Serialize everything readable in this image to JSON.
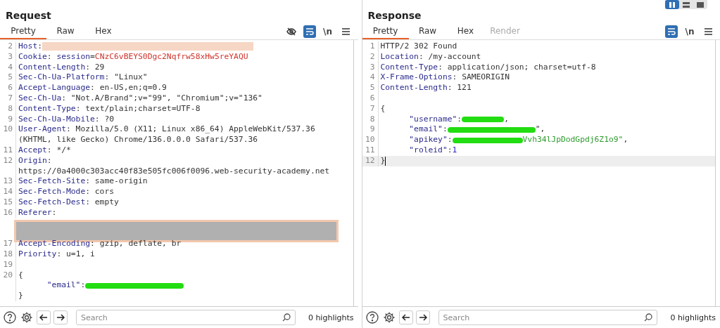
{
  "layout_buttons": [
    {
      "selected": true
    },
    {
      "selected": false
    },
    {
      "selected": false
    }
  ],
  "panels": [
    {
      "title": "Request",
      "tabs": [
        {
          "label": "Pretty",
          "selected": true,
          "disabled": false
        },
        {
          "label": "Raw",
          "selected": false,
          "disabled": false
        },
        {
          "label": "Hex",
          "selected": false,
          "disabled": false
        }
      ],
      "tools": [
        {
          "kind": "hide"
        },
        {
          "kind": "wrap",
          "on": true
        },
        {
          "kind": "newline",
          "text": "\\n"
        },
        {
          "kind": "menu"
        }
      ],
      "lines": [
        {
          "num": "2",
          "segments": [
            {
              "kind": "key",
              "text": "Host"
            },
            {
              "kind": "plain",
              "text": ":"
            },
            {
              "kind": "strike"
            }
          ]
        },
        {
          "num": "3",
          "segments": [
            {
              "kind": "key",
              "text": "Cookie"
            },
            {
              "kind": "plain",
              "text": ": "
            },
            {
              "kind": "param",
              "text": "session"
            },
            {
              "kind": "plain",
              "text": "="
            },
            {
              "kind": "red",
              "text": "CNzC6vBEYS0Dgc2Nqfrw58xHw5reYAQU"
            }
          ]
        },
        {
          "num": "4",
          "segments": [
            {
              "kind": "key",
              "text": "Content-Length"
            },
            {
              "kind": "plain",
              "text": ": 29"
            }
          ]
        },
        {
          "num": "5",
          "segments": [
            {
              "kind": "key",
              "text": "Sec-Ch-Ua-Platform"
            },
            {
              "kind": "plain",
              "text": ": \"Linux\""
            }
          ]
        },
        {
          "num": "6",
          "segments": [
            {
              "kind": "key",
              "text": "Accept-Language"
            },
            {
              "kind": "plain",
              "text": ": en-US,en;q=0.9"
            }
          ]
        },
        {
          "num": "7",
          "segments": [
            {
              "kind": "key",
              "text": "Sec-Ch-Ua"
            },
            {
              "kind": "plain",
              "text": ": \"Not.A/Brand\";v=\"99\", \"Chromium\";v=\"136\""
            }
          ]
        },
        {
          "num": "8",
          "segments": [
            {
              "kind": "key",
              "text": "Content-Type"
            },
            {
              "kind": "plain",
              "text": ": text/plain;charset=UTF-8"
            }
          ]
        },
        {
          "num": "9",
          "segments": [
            {
              "kind": "key",
              "text": "Sec-Ch-Ua-Mobile"
            },
            {
              "kind": "plain",
              "text": ": ?0"
            }
          ]
        },
        {
          "num": "10",
          "segments": [
            {
              "kind": "key",
              "text": "User-Agent"
            },
            {
              "kind": "plain",
              "text": ": Mozilla/5.0 (X11; Linux x86_64) AppleWebKit/537.36"
            }
          ]
        },
        {
          "segments": [
            {
              "kind": "plain",
              "text": "(KHTML, like Gecko) Chrome/136.0.0.0 Safari/537.36"
            }
          ]
        },
        {
          "num": "11",
          "segments": [
            {
              "kind": "key",
              "text": "Accept"
            },
            {
              "kind": "plain",
              "text": ": */*"
            }
          ]
        },
        {
          "num": "12",
          "segments": [
            {
              "kind": "key",
              "text": "Origin"
            },
            {
              "kind": "plain",
              "text": ":"
            }
          ]
        },
        {
          "segments": [
            {
              "kind": "plain",
              "text": "https://0a4000c303acc40f83e505fc006f0096.web-security-academy.net"
            }
          ]
        },
        {
          "num": "13",
          "segments": [
            {
              "kind": "key",
              "text": "Sec-Fetch-Site"
            },
            {
              "kind": "plain",
              "text": ": same-origin"
            }
          ]
        },
        {
          "num": "14",
          "segments": [
            {
              "kind": "key",
              "text": "Sec-Fetch-Mode"
            },
            {
              "kind": "plain",
              "text": ": cors"
            }
          ]
        },
        {
          "num": "15",
          "segments": [
            {
              "kind": "key",
              "text": "Sec-Fetch-Dest"
            },
            {
              "kind": "plain",
              "text": ": empty"
            }
          ]
        },
        {
          "num": "16",
          "segments": [
            {
              "kind": "key",
              "text": "Referer"
            },
            {
              "kind": "plain",
              "text": ":"
            }
          ]
        },
        {
          "segments": [
            {
              "kind": "block"
            }
          ]
        },
        {
          "num": "17",
          "segments": [
            {
              "kind": "key",
              "text": "Accept-Encoding"
            },
            {
              "kind": "plain",
              "text": ": gzip, deflate, br"
            }
          ]
        },
        {
          "num": "18",
          "segments": [
            {
              "kind": "key",
              "text": "Priority"
            },
            {
              "kind": "plain",
              "text": ": u=1, i"
            }
          ]
        },
        {
          "num": "19"
        },
        {
          "num": "20",
          "segments": [
            {
              "kind": "plain",
              "text": "{"
            }
          ]
        },
        {
          "segments": [
            {
              "kind": "indent"
            },
            {
              "kind": "param",
              "text": "\"email\""
            },
            {
              "kind": "plain",
              "text": ":"
            },
            {
              "kind": "scribble"
            }
          ]
        },
        {
          "segments": [
            {
              "kind": "plain",
              "text": "}"
            }
          ]
        }
      ],
      "search": {
        "placeholder": "Search"
      },
      "highlights": "0 highlights"
    },
    {
      "title": "Response",
      "tabs": [
        {
          "label": "Pretty",
          "selected": true,
          "disabled": false
        },
        {
          "label": "Raw",
          "selected": false,
          "disabled": false
        },
        {
          "label": "Hex",
          "selected": false,
          "disabled": false
        },
        {
          "label": "Render",
          "selected": false,
          "disabled": true
        }
      ],
      "tools": [
        {
          "kind": "wrap",
          "on": true
        },
        {
          "kind": "newline",
          "text": "\\n"
        },
        {
          "kind": "menu"
        }
      ],
      "lines": [
        {
          "num": "1",
          "segments": [
            {
              "kind": "plain",
              "text": "HTTP/2 302 Found"
            }
          ]
        },
        {
          "num": "2",
          "segments": [
            {
              "kind": "key",
              "text": "Location"
            },
            {
              "kind": "plain",
              "text": ": /my-account"
            }
          ]
        },
        {
          "num": "3",
          "segments": [
            {
              "kind": "key",
              "text": "Content-Type"
            },
            {
              "kind": "plain",
              "text": ": application/json; charset=utf-8"
            }
          ]
        },
        {
          "num": "4",
          "segments": [
            {
              "kind": "key",
              "text": "X-Frame-Options"
            },
            {
              "kind": "plain",
              "text": ": SAMEORIGIN"
            }
          ]
        },
        {
          "num": "5",
          "segments": [
            {
              "kind": "key",
              "text": "Content-Length"
            },
            {
              "kind": "plain",
              "text": ": 121"
            }
          ]
        },
        {
          "num": "6"
        },
        {
          "num": "7",
          "segments": [
            {
              "kind": "plain",
              "text": "{"
            }
          ]
        },
        {
          "num": "8",
          "segments": [
            {
              "kind": "indent"
            },
            {
              "kind": "param",
              "text": "\"username\""
            },
            {
              "kind": "plain",
              "text": ":"
            },
            {
              "kind": "scribble"
            },
            {
              "kind": "plain",
              "text": ","
            }
          ]
        },
        {
          "num": "9",
          "segments": [
            {
              "kind": "indent"
            },
            {
              "kind": "param",
              "text": "\"email\""
            },
            {
              "kind": "plain",
              "text": ":"
            },
            {
              "kind": "scribble"
            },
            {
              "kind": "plain",
              "text": "\","
            }
          ]
        },
        {
          "num": "10",
          "segments": [
            {
              "kind": "indent"
            },
            {
              "kind": "param",
              "text": "\"apikey\""
            },
            {
              "kind": "plain",
              "text": ":"
            },
            {
              "kind": "scribble"
            },
            {
              "kind": "string",
              "text": "Vvh34lJpDodGpdj6Z1o9\""
            },
            {
              "kind": "plain",
              "text": ","
            }
          ]
        },
        {
          "num": "11",
          "segments": [
            {
              "kind": "indent"
            },
            {
              "kind": "param",
              "text": "\"roleid\""
            },
            {
              "kind": "plain",
              "text": ":"
            },
            {
              "kind": "number",
              "text": "1"
            }
          ]
        },
        {
          "num": "12",
          "current": true,
          "segments": [
            {
              "kind": "plain",
              "text": "}"
            }
          ]
        }
      ],
      "search": {
        "placeholder": "Search"
      },
      "highlights": "0 highlights"
    }
  ]
}
